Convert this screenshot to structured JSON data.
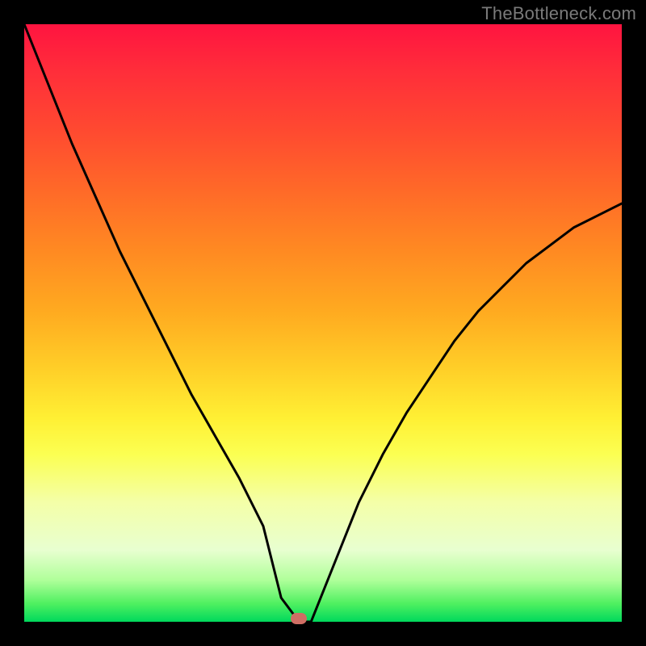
{
  "watermark": "TheBottleneck.com",
  "colors": {
    "frame_bg": "#000000",
    "curve": "#000000",
    "marker": "#cf6e64",
    "gradient_stops": [
      "#ff1440",
      "#ff2e3a",
      "#ff4a30",
      "#ff6a28",
      "#ff8a22",
      "#ffaa20",
      "#ffd028",
      "#fff034",
      "#fbff52",
      "#f4ffa8",
      "#e8ffd0",
      "#b0ff9a",
      "#4ef060",
      "#00d85c"
    ]
  },
  "chart_data": {
    "type": "line",
    "title": "",
    "xlabel": "",
    "ylabel": "",
    "xlim": [
      0,
      100
    ],
    "ylim": [
      0,
      100
    ],
    "grid": false,
    "marker": {
      "x": 46,
      "y": 0,
      "note": "minimum point highlighted"
    },
    "series": [
      {
        "name": "bottleneck-curve",
        "x": [
          0,
          4,
          8,
          12,
          16,
          20,
          24,
          28,
          32,
          36,
          40,
          43,
          46,
          48,
          52,
          56,
          60,
          64,
          68,
          72,
          76,
          80,
          84,
          88,
          92,
          96,
          100
        ],
        "y": [
          100,
          90,
          80,
          71,
          62,
          54,
          46,
          38,
          31,
          24,
          16,
          4,
          0,
          0,
          10,
          20,
          28,
          35,
          41,
          47,
          52,
          56,
          60,
          63,
          66,
          68,
          70
        ]
      }
    ]
  }
}
